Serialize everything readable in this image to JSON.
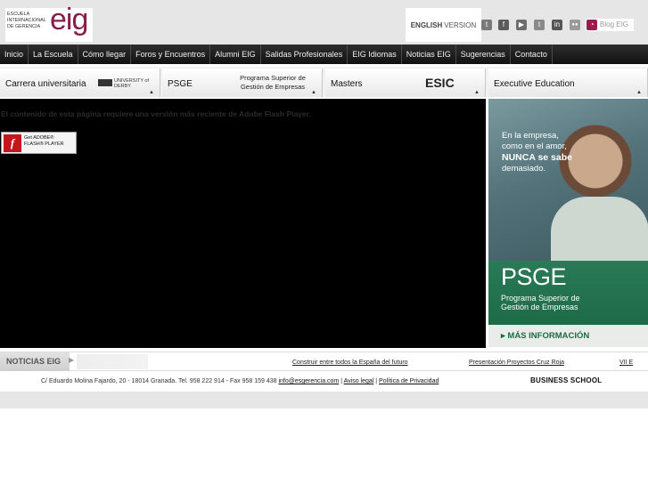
{
  "header": {
    "logo_small": "ESCUELA INTERNACIONAL DE GERENCIA",
    "logo_big": "eig",
    "english_bold": "ENGLISH",
    "english_rest": "VERSION",
    "blog": "Blog EIG",
    "social_icons": [
      "tuenti-icon",
      "facebook-icon",
      "youtube-icon",
      "twitter-icon",
      "linkedin-icon",
      "flickr-icon"
    ]
  },
  "nav": {
    "items": [
      "Inicio",
      "La Escuela",
      "Cómo llegar",
      "Foros y Encuentros",
      "Alumni EIG",
      "Salidas Profesionales",
      "EIG Idiomas",
      "Noticias EIG",
      "Sugerencias",
      "Contacto"
    ]
  },
  "tabs": {
    "carrera": "Carrera universitaria",
    "derby": "UNIVERSITY of DERBY",
    "psge": "PSGE",
    "psge_sub": "Programa Superior de Gestión de Empresas",
    "masters": "Masters",
    "esic": "ESIC",
    "executive": "Executive Education"
  },
  "flash": {
    "message": "El contenido de esta página requiere una versión más reciente de Adobe Flash Player.",
    "get_line1": "Get ADOBE®",
    "get_line2": "FLASH® PLAYER"
  },
  "promo": {
    "quote_line1": "En la empresa,",
    "quote_line2": "como en el amor,",
    "quote_line3": "NUNCA se sabe",
    "quote_line4": "demasiado.",
    "title": "PSGE",
    "program_line1": "Programa Superior de",
    "program_line2": "Gestión de Empresas",
    "more": "▸ MÁS INFORMACIÓN"
  },
  "news": {
    "title": "NOTICIAS EIG",
    "links": [
      "Construir entre todos la España del futuro",
      "Presentación Proyectos Cruz Roja",
      "VII E"
    ]
  },
  "footer": {
    "address": "C/ Eduardo Molina Fajardo, 20 - 18014 Granada. Tel. 958 222 914 - Fax 958 159 438",
    "email": "info@esgerencia.com",
    "legal": "Aviso legal",
    "privacy": "Política de Privacidad",
    "business_school": "BUSINESS SCHOOL"
  }
}
